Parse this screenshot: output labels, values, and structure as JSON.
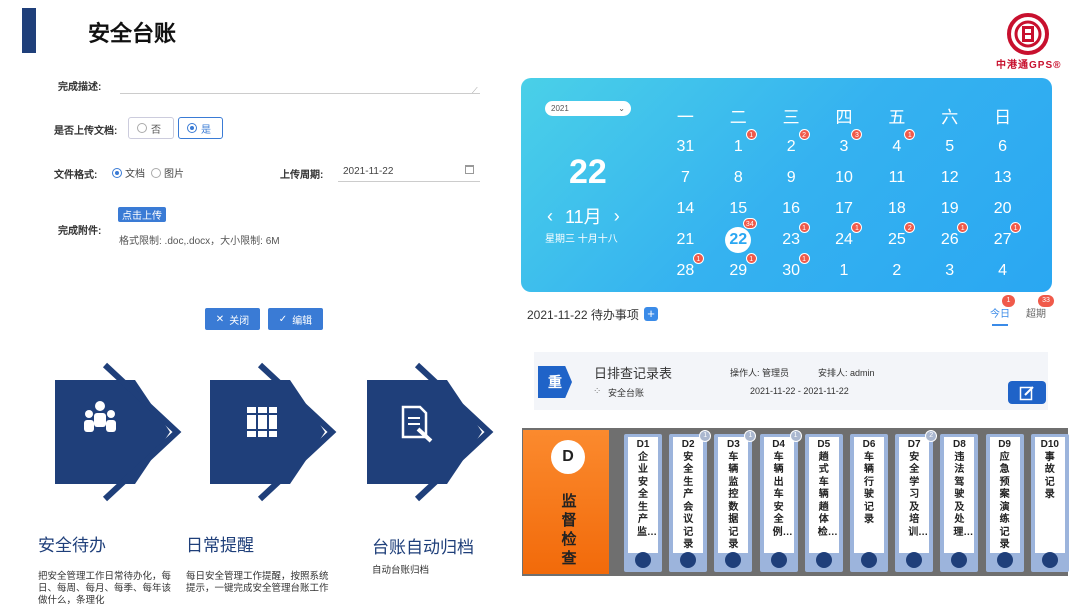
{
  "header": {
    "title": "安全台账",
    "logo_text": "中港通GPS®"
  },
  "form": {
    "desc_label": "完成描述:",
    "upload_label": "是否上传文档:",
    "upload_options": [
      "否",
      "是"
    ],
    "format_label": "文件格式:",
    "format_options": [
      "文档",
      "图片"
    ],
    "period_label": "上传周期:",
    "period_value": "2021-11-22",
    "attach_label": "完成附件:",
    "upload_button": "点击上传",
    "limit_text": "格式限制: .doc,.docx，大小限制: 6M",
    "close_button": "关闭",
    "edit_button": "编辑"
  },
  "features": [
    {
      "title": "安全待办",
      "desc": "把安全管理工作日常待办化，每日、每周、每月、每季、每年该做什么，条理化"
    },
    {
      "title": "日常提醒",
      "desc": "每日安全管理工作提醒，按照系统提示，一键完成安全管理台账工作"
    },
    {
      "title": "台账自动归档",
      "desc": "自动台账归档"
    }
  ],
  "calendar": {
    "year": "2021",
    "day": "22",
    "month": "11月",
    "prev": "‹",
    "next": "›",
    "week_info": "星期三  十月十八",
    "weekdays": [
      "一",
      "二",
      "三",
      "四",
      "五",
      "六",
      "日"
    ],
    "rows": [
      [
        "31",
        "1",
        "2",
        "3",
        "4",
        "5",
        "6"
      ],
      [
        "7",
        "8",
        "9",
        "10",
        "11",
        "12",
        "13"
      ],
      [
        "14",
        "15",
        "16",
        "17",
        "18",
        "19",
        "20"
      ],
      [
        "21",
        "22",
        "23",
        "24",
        "25",
        "26",
        "27"
      ],
      [
        "28",
        "29",
        "30",
        "1",
        "2",
        "3",
        "4"
      ]
    ],
    "badges": {
      "0-1": "1",
      "0-2": "2",
      "0-3": "3",
      "0-4": "1",
      "3-1": "34",
      "3-2": "1",
      "3-3": "1",
      "3-4": "2",
      "3-5": "1",
      "3-6": "1",
      "4-0": "1",
      "4-1": "1",
      "4-2": "1"
    }
  },
  "todo": {
    "title": "2021-11-22 待办事项",
    "tab_today": "今日",
    "tab_today_count": "1",
    "tab_overdue": "超期",
    "tab_overdue_count": "33"
  },
  "task": {
    "icon_text": "重",
    "name": "日排查记录表",
    "operator": "操作人: 管理员",
    "arranger": "安排人: admin",
    "category": "安全台账",
    "date_range": "2021-11-22 - 2021-11-22"
  },
  "shelf": {
    "circle": "D",
    "label": "监督检查",
    "binders": [
      {
        "code": "D1",
        "name": "企业安全生产监…",
        "badge": ""
      },
      {
        "code": "D2",
        "name": "安全生产会议记录",
        "badge": "1"
      },
      {
        "code": "D3",
        "name": "车辆监控数据记录",
        "badge": "1"
      },
      {
        "code": "D4",
        "name": "车辆出车安全例…",
        "badge": "1"
      },
      {
        "code": "D5",
        "name": "趟式车辆趟体检…",
        "badge": ""
      },
      {
        "code": "D6",
        "name": "车辆行驶记录",
        "badge": ""
      },
      {
        "code": "D7",
        "name": "安全学习及培训…",
        "badge": "2"
      },
      {
        "code": "D8",
        "name": "违法驾驶及处理…",
        "badge": ""
      },
      {
        "code": "D9",
        "name": "应急预案演练记录",
        "badge": ""
      },
      {
        "code": "D10",
        "name": "事故记录",
        "badge": ""
      }
    ]
  }
}
